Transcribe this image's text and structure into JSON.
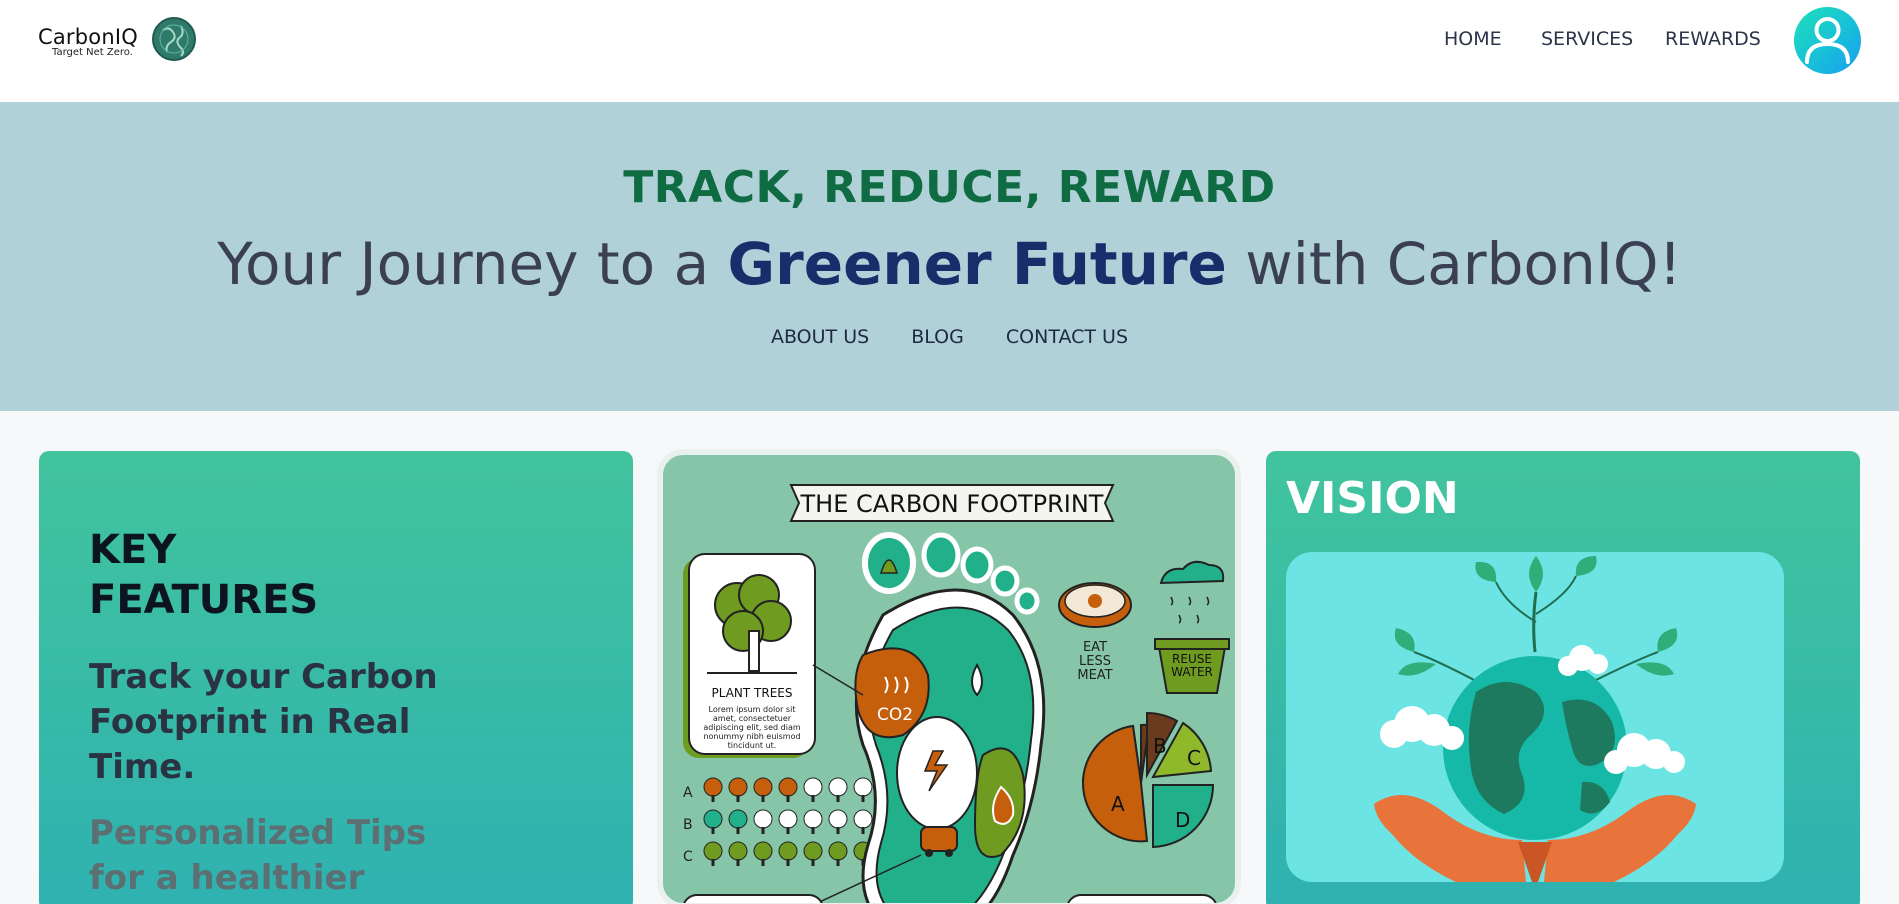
{
  "brand": {
    "name": "CarbonIQ",
    "tagline": "Target Net Zero."
  },
  "nav": {
    "items": [
      "HOME",
      "SERVICES",
      "REWARDS"
    ]
  },
  "hero": {
    "kicker": "TRACK, REDUCE, REWARD",
    "title_before": "Your Journey to a ",
    "title_highlight": "Greener Future",
    "title_after": " with CarbonIQ!",
    "links": [
      "ABOUT US",
      "BLOG",
      "CONTACT US"
    ]
  },
  "features": {
    "title": "KEY FEATURES",
    "items": [
      "Track your Carbon Footprint in Real Time.",
      "Personalized Tips for a healthier"
    ]
  },
  "infographic": {
    "title": "THE CARBON FOOTPRINT",
    "plant_trees": "PLANT TREES",
    "lorem": "Lorem ipsum dolor sit amet, consectetuer adipiscing elit, sed diam nonummy nibh euismod tincidunt ut.",
    "co2": "CO2",
    "eat_less_meat": "EAT LESS MEAT",
    "reuse_water": "REUSE WATER",
    "rows": [
      "A",
      "B",
      "C"
    ],
    "pie_labels": [
      "A",
      "B",
      "C",
      "D"
    ]
  },
  "vision": {
    "title": "VISION"
  },
  "colors": {
    "accent_green": "#0e6b42",
    "accent_navy": "#1a2d6b",
    "hero_bg": "#b0d1d8",
    "card_gradient_top": "#41c49d",
    "card_gradient_bottom": "#2fb1b1"
  }
}
